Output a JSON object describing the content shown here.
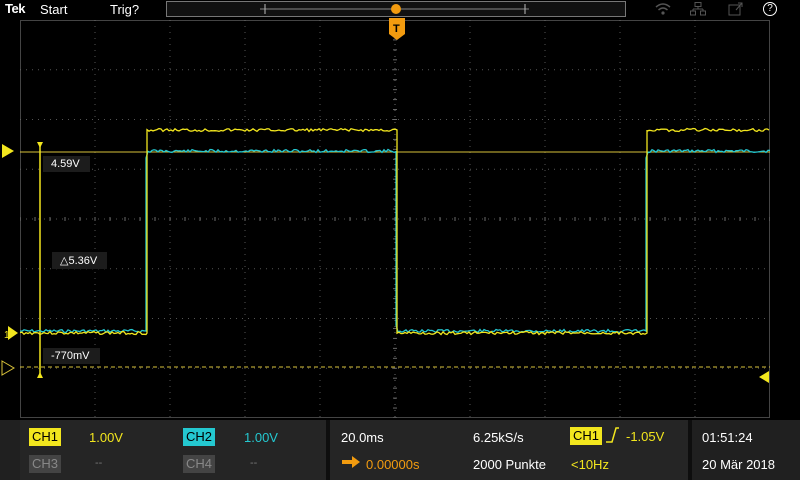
{
  "topbar": {
    "brand": "Tek",
    "run_state": "Start",
    "trigger_status": "Trig?"
  },
  "colors": {
    "ch1": "#f2e61e",
    "ch2": "#24c8d0",
    "cursor": "#d9c23a",
    "grid": "#6b6b6b",
    "trigger": "#f29b0f"
  },
  "markers": {
    "ch1": "1",
    "trigger": "T"
  },
  "cursors": {
    "upper_value": "4.59V",
    "delta_value": "△5.36V",
    "lower_value": "-770mV"
  },
  "bottom": {
    "ch1": {
      "label": "CH1",
      "scale": "1.00V"
    },
    "ch2": {
      "label": "CH2",
      "scale": "1.00V"
    },
    "ch3": {
      "label": "CH3",
      "scale": "--"
    },
    "ch4": {
      "label": "CH4",
      "scale": "--"
    },
    "horizontal": {
      "timebase": "20.0ms",
      "position": "0.00000s"
    },
    "acquisition": {
      "sample_rate": "6.25kS/s",
      "record_length": "2000 Punkte"
    },
    "trigger": {
      "source": "CH1",
      "level": "-1.05V",
      "frequency": "<10Hz"
    },
    "clock": {
      "time": "01:51:24",
      "date": "20 Mär 2018"
    }
  }
}
